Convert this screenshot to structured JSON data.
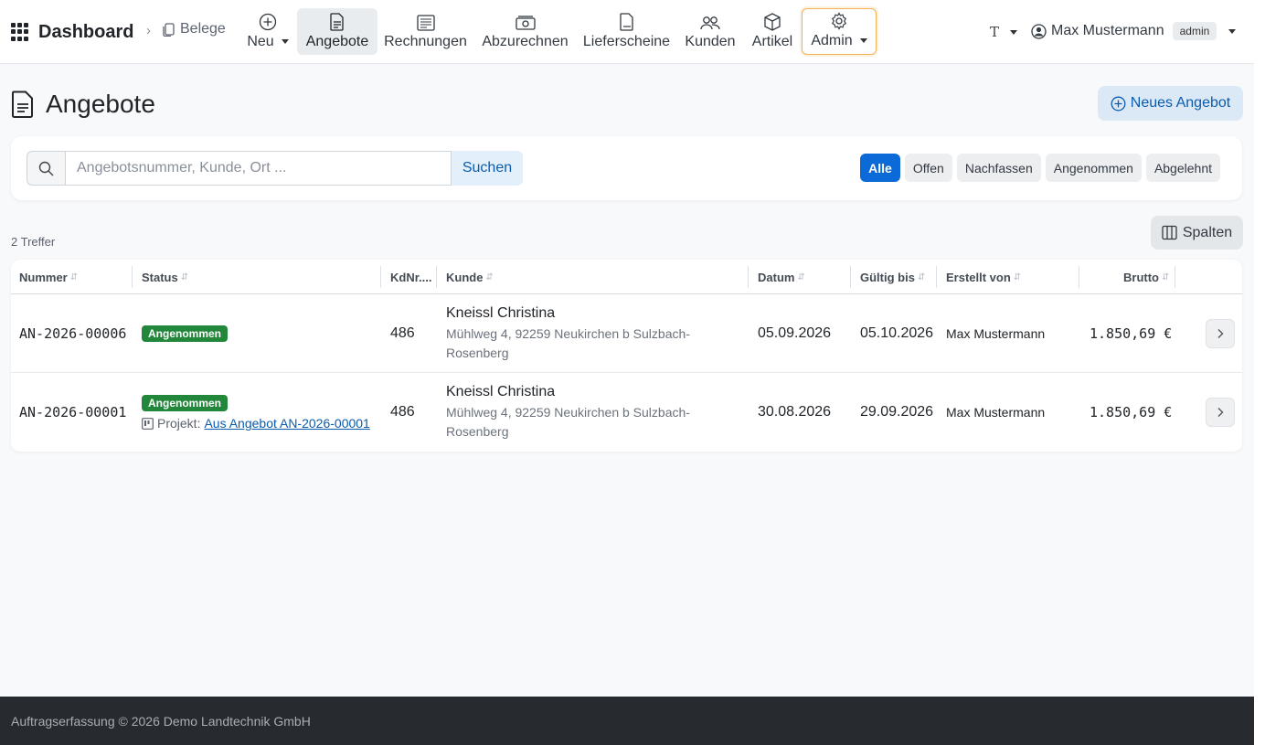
{
  "nav": {
    "brand": "Dashboard",
    "breadcrumb": "Belege",
    "items": [
      {
        "label": "Neu"
      },
      {
        "label": "Angebote"
      },
      {
        "label": "Rechnungen"
      },
      {
        "label": "Abzurechnen"
      },
      {
        "label": "Lieferscheine"
      },
      {
        "label": "Kunden"
      },
      {
        "label": "Artikel"
      },
      {
        "label": "Admin"
      }
    ],
    "lang": "T",
    "user": "Max Mustermann",
    "role": "admin"
  },
  "page": {
    "title": "Angebote",
    "new_button": "Neues Angebot"
  },
  "search": {
    "placeholder": "Angebotsnummer, Kunde, Ort ...",
    "value": "",
    "button": "Suchen"
  },
  "filters": [
    "Alle",
    "Offen",
    "Nachfassen",
    "Angenommen",
    "Abgelehnt"
  ],
  "active_filter": "Alle",
  "hits": "2 Treffer",
  "columns_button": "Spalten",
  "table": {
    "headers": [
      "Nummer",
      "Status",
      "KdNr....",
      "Kunde",
      "Datum",
      "Gültig bis",
      "Erstellt von",
      "Brutto"
    ],
    "rows": [
      {
        "nummer": "AN-2026-00006",
        "status": "Angenommen",
        "kdnr": "486",
        "kunde_name": "Kneissl Christina",
        "kunde_adresse": "Mühlweg 4, 92259 Neukirchen b Sulzbach-Rosenberg",
        "datum": "05.09.2026",
        "gueltig": "05.10.2026",
        "erstellt": "Max Mustermann",
        "brutto": "1.850,69 €"
      },
      {
        "nummer": "AN-2026-00001",
        "status": "Angenommen",
        "projekt_label": "Projekt:",
        "projekt_link": "Aus Angebot AN-2026-00001",
        "kdnr": "486",
        "kunde_name": "Kneissl Christina",
        "kunde_adresse": "Mühlweg 4, 92259 Neukirchen b Sulzbach-Rosenberg",
        "datum": "30.08.2026",
        "gueltig": "29.09.2026",
        "erstellt": "Max Mustermann",
        "brutto": "1.850,69 €"
      }
    ]
  },
  "footer": "Auftragserfassung © 2026 Demo Landtechnik GmbH",
  "colors": {
    "accent": "#0b6ad8",
    "success": "#22873a",
    "footer_bg": "#272b30"
  }
}
